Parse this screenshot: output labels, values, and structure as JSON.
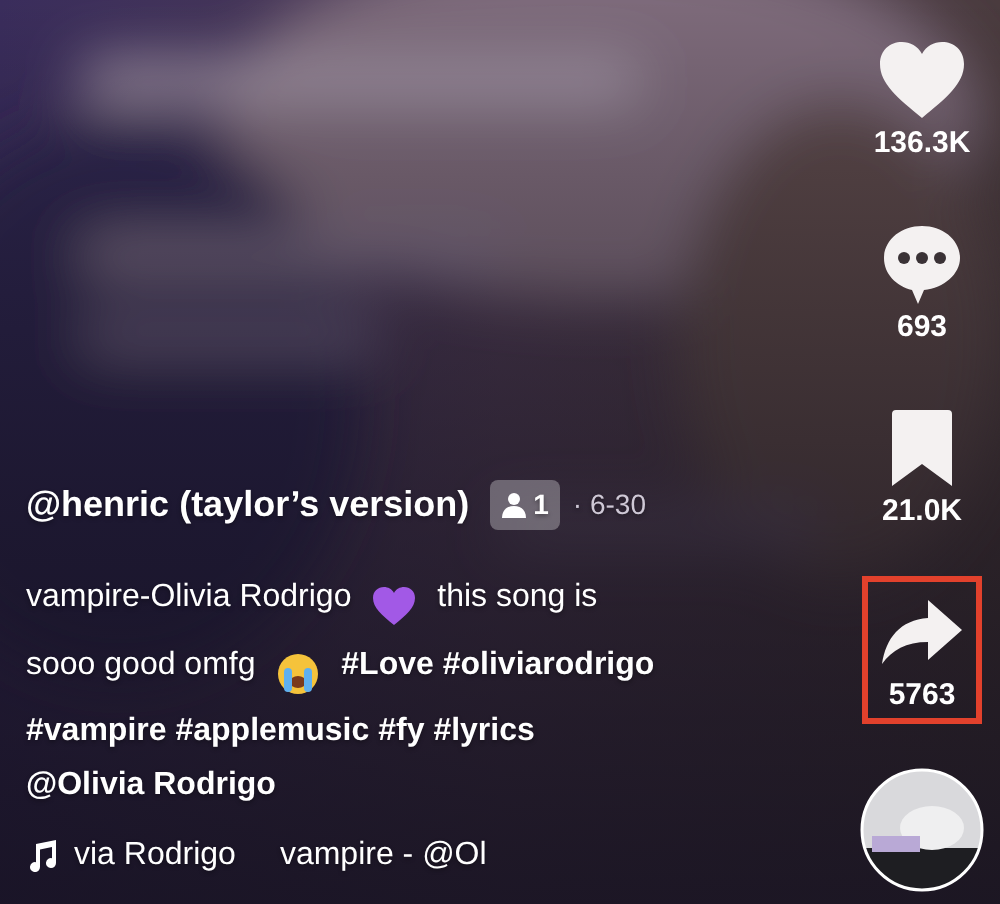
{
  "video": {
    "kind": "picture"
  },
  "actions": [
    {
      "kind": "like",
      "count": "136.3K",
      "highlighted": false
    },
    {
      "kind": "comment",
      "count": "693",
      "highlighted": false
    },
    {
      "kind": "bookmark",
      "count": "21.0K",
      "highlighted": false
    },
    {
      "kind": "share",
      "count": "5763",
      "highlighted": true
    }
  ],
  "author": {
    "name": "@henric (taylor’s version)",
    "friends": "1",
    "date": "· 6-30"
  },
  "caption": [
    [
      {
        "kind": "text",
        "text": "vampire-Olivia Rodrigo"
      },
      {
        "kind": "heart",
        "color": "#a259e6"
      },
      {
        "kind": "text",
        "text": "this song is"
      }
    ],
    [
      {
        "kind": "text",
        "text": "sooo good omfg"
      },
      {
        "kind": "crying"
      },
      {
        "kind": "tag",
        "text": "#Love"
      },
      {
        "kind": "tag",
        "text": "#oliviarodrigo"
      }
    ],
    [
      {
        "kind": "tag",
        "text": "#vampire"
      },
      {
        "kind": "tag",
        "text": "#applemusic"
      },
      {
        "kind": "tag",
        "text": "#fy"
      },
      {
        "kind": "tag",
        "text": "#lyrics"
      }
    ],
    [
      {
        "kind": "mention",
        "text": "@Olivia Rodrigo"
      }
    ]
  ],
  "sound": {
    "artist": "via Rodrigo",
    "title": "vampire - @Ol"
  }
}
